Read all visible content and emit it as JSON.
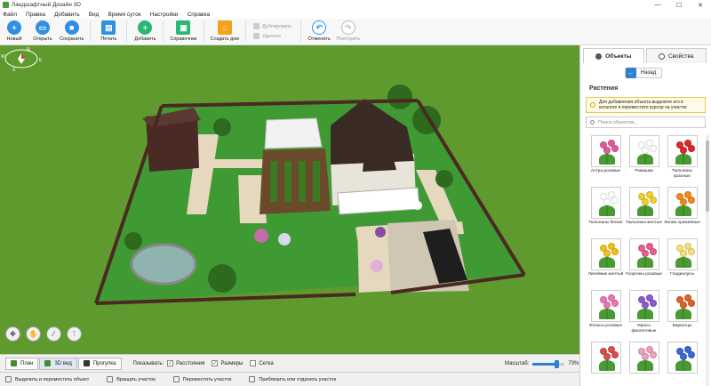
{
  "window": {
    "title": "Ландшафтный Дизайн 3D",
    "min": "—",
    "max": "☐",
    "close": "✕"
  },
  "menu": [
    "Файл",
    "Правка",
    "Добавить",
    "Вид",
    "Время суток",
    "Настройки",
    "Справка"
  ],
  "toolbar": {
    "new": "Новый",
    "open": "Открыть",
    "save": "Сохранить",
    "print": "Печать",
    "add": "Добавить",
    "reference": "Справочник",
    "build_house": "Создать дом",
    "duplicate": "Дублировать",
    "delete": "Удалить",
    "undo": "Отменить",
    "redo": "Повторить"
  },
  "compass": {
    "n": "N",
    "s": "S",
    "e": "E",
    "w": "W"
  },
  "sidebar": {
    "tab_objects": "Объекты",
    "tab_properties": "Свойства",
    "back": "Назад",
    "category": "Растения",
    "hint": "Для добавления объекта выделите его в каталоге и переместите курсор на участок",
    "search_placeholder": "Поиск объектов...",
    "items": [
      "Астра розовые",
      "Ромашки",
      "Тюльпаны красные",
      "Тюльпаны белые",
      "Тюльпаны желтые",
      "Лилии оранжевые",
      "Лилейник желтый",
      "Георгины розовые",
      "Гладиолусы",
      "Флоксы розовые",
      "Ирисы фиолетовые",
      "Бархатцы",
      "",
      "",
      ""
    ]
  },
  "bottombar": {
    "plan": "План",
    "view3d": "3D вид",
    "walk": "Прогулка",
    "show": "Показывать:",
    "distances": "Расстояния",
    "sizes": "Размеры",
    "grid": "Сетка",
    "zoom_label": "Масштаб:",
    "zoom_value": "73%",
    "zoom_fraction": 0.73
  },
  "status": [
    "Выделить и переместить объект",
    "Вращать участок",
    "Переместить участок",
    "Приблизить или отдалить участок"
  ],
  "colors": {
    "accent": "#2f7fd6",
    "grass": "#5e9a2e",
    "lawn": "#3f9a34",
    "roof": "#3a2a24"
  }
}
